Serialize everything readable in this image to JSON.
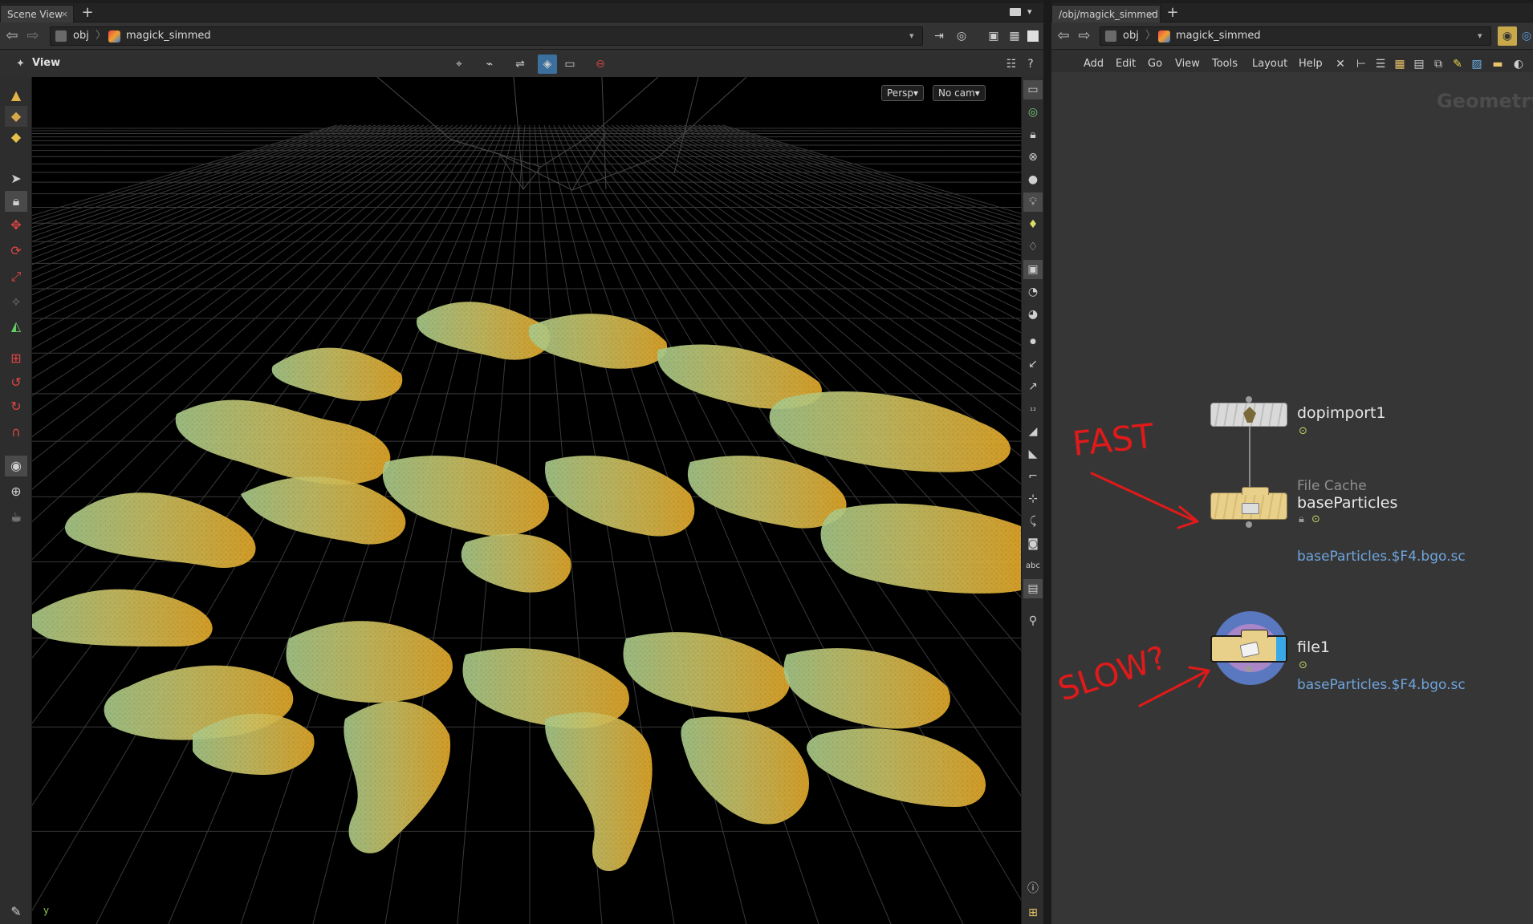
{
  "left_pane": {
    "tab_label": "Scene View",
    "tab_close": "×",
    "add_tab": "+",
    "path": [
      "obj",
      "magick_simmed"
    ],
    "view_label": "View",
    "persp_button": "Persp▾",
    "cam_button": "No cam▾",
    "axis_label": "y"
  },
  "right_pane": {
    "tab_label": "/obj/magick_simmed",
    "tab_close": "×",
    "add_tab": "+",
    "path": [
      "obj",
      "magick_simmed"
    ],
    "menu": [
      "Add",
      "Edit",
      "Go",
      "View",
      "Tools",
      "Layout",
      "Help"
    ],
    "context_label": "Geometry"
  },
  "nodes": [
    {
      "name": "dopimport1",
      "type_label": "",
      "param": ""
    },
    {
      "name": "baseParticles",
      "type_label": "File Cache",
      "param": "baseParticles.$F4.bgo.sc"
    },
    {
      "name": "file1",
      "type_label": "",
      "param": "baseParticles.$F4.bgo.sc"
    }
  ],
  "annotations": {
    "fast": "FAST",
    "slow": "SLOW?"
  },
  "colors": {
    "accent_blue": "#3b6f9e",
    "node_yellow": "#e8cf8a",
    "param_blue": "#6fa4dc",
    "annotation_red": "#e01a1a",
    "particle_green": "#9bbf6a",
    "particle_gold": "#e3a92a"
  },
  "icons": {
    "left_toolbar": [
      "select-icon",
      "lock-icon",
      "translate-icon",
      "rotate-icon",
      "scale-icon",
      "handle-icon",
      "pose-icon",
      "snap-icon",
      "magnet-icon",
      "camera-icon",
      "render-icon"
    ],
    "right_toolbar": [
      "display-icon",
      "lock-icon",
      "ghost-icon",
      "shading-icon",
      "light-icon",
      "point-icon",
      "normal-icon",
      "number-icon",
      "text-icon",
      "info-icon",
      "grid-icon"
    ]
  }
}
